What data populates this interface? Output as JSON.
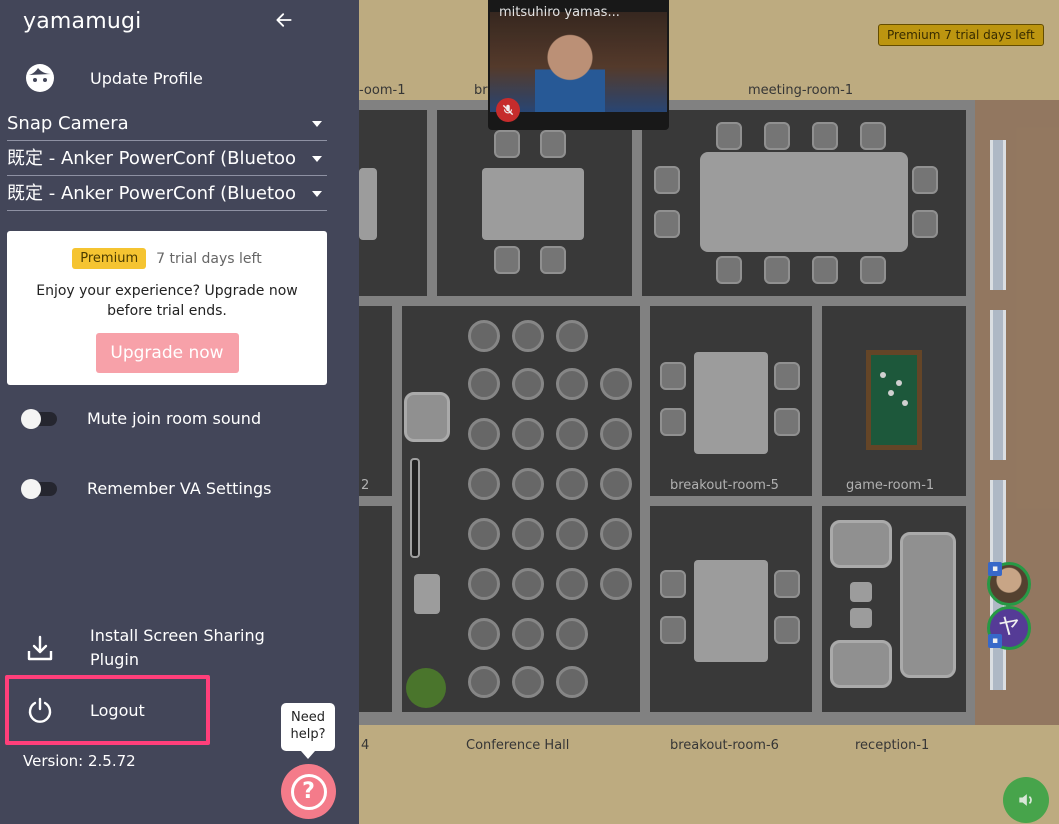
{
  "sidebar": {
    "app_title": "yamamugi",
    "update_profile_label": "Update Profile",
    "camera_select": "Snap Camera",
    "mic_select": "既定 - Anker PowerConf (Bluetoo",
    "speaker_select": "既定 - Anker PowerConf (Bluetoo",
    "promo": {
      "badge": "Premium",
      "trial_text": "7 trial days left",
      "message": "Enjoy your experience? Upgrade now before trial ends.",
      "button_label": "Upgrade now"
    },
    "toggles": [
      {
        "label": "Mute join room sound",
        "on": false
      },
      {
        "label": "Remember VA Settings",
        "on": false
      }
    ],
    "install_label": "Install Screen Sharing Plugin",
    "logout_label": "Logout",
    "version": "Version: 2.5.72"
  },
  "help": {
    "bubble_text": "Need help?",
    "icon": "question-icon"
  },
  "map": {
    "premium_tag": "Premium 7 trial days left",
    "video": {
      "name": "mitsuhiro yamas..."
    },
    "labels": {
      "top_room_1": "-oom-1",
      "top_room_2": "br",
      "meeting_room": "meeting-room-1",
      "breakout_5": "breakout-room-5",
      "game_room": "game-room-1",
      "left_2": "2",
      "bottom_4": "4",
      "conference": "Conference Hall",
      "breakout_6": "breakout-room-6",
      "reception": "reception-1"
    },
    "avatar_2_letter": "ヤ"
  },
  "colors": {
    "sidebar_bg": "#434659",
    "highlight": "#ff3f7a",
    "premium": "#f5c431",
    "upgrade_btn": "#f7a1a9"
  }
}
